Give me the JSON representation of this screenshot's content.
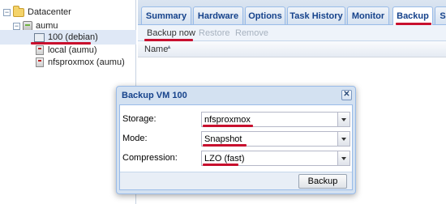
{
  "tree": {
    "datacenter": "Datacenter",
    "node": "aumu",
    "vm": "100 (debian)",
    "storages": [
      "local (aumu)",
      "nfsproxmox (aumu)"
    ]
  },
  "tabs": [
    "Summary",
    "Hardware",
    "Options",
    "Task History",
    "Monitor",
    "Backup",
    "S"
  ],
  "active_tab": "Backup",
  "toolbar": {
    "backup_now": "Backup now",
    "restore": "Restore",
    "remove": "Remove"
  },
  "grid": {
    "column": "Name",
    "sort_icon": "sort-ascending-icon"
  },
  "dialog": {
    "title": "Backup VM 100",
    "close_icon": "close-icon",
    "close_glyph": "✕",
    "fields": [
      {
        "label": "Storage:",
        "value": "nfsproxmox"
      },
      {
        "label": "Mode:",
        "value": "Snapshot"
      },
      {
        "label": "Compression:",
        "value": "LZO (fast)"
      }
    ],
    "submit": "Backup"
  },
  "colors": {
    "annotation": "#c8102e",
    "tab_text": "#15428b",
    "selection": "#dfe8f6"
  }
}
